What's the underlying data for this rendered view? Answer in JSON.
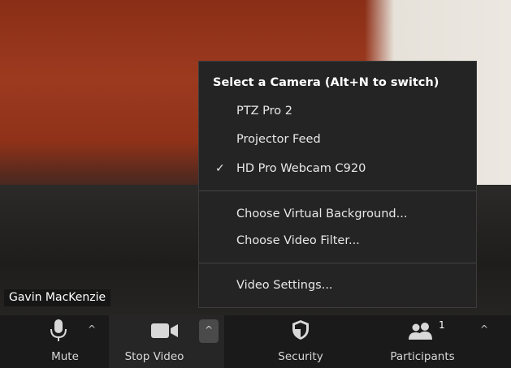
{
  "participant": {
    "name": "Gavin MacKenzie"
  },
  "camera_menu": {
    "title": "Select a Camera (Alt+N to switch)",
    "cameras": [
      {
        "label": "PTZ Pro 2",
        "checked": false
      },
      {
        "label": "Projector Feed",
        "checked": false
      },
      {
        "label": "HD Pro Webcam C920",
        "checked": true
      }
    ],
    "check_mark": "✓",
    "options": [
      "Choose Virtual Background...",
      "Choose Video Filter..."
    ],
    "settings": "Video Settings..."
  },
  "toolbar": {
    "mute": {
      "label": "Mute",
      "icon": "microphone-icon"
    },
    "stop_video": {
      "label": "Stop Video",
      "icon": "video-camera-icon"
    },
    "security": {
      "label": "Security",
      "icon": "shield-icon"
    },
    "participants": {
      "label": "Participants",
      "icon": "people-icon",
      "count": "1"
    },
    "caret": "^"
  },
  "colors": {
    "menu_bg": "#242424",
    "toolbar_bg": "#1a1a1a",
    "text": "#e8e8e8"
  }
}
